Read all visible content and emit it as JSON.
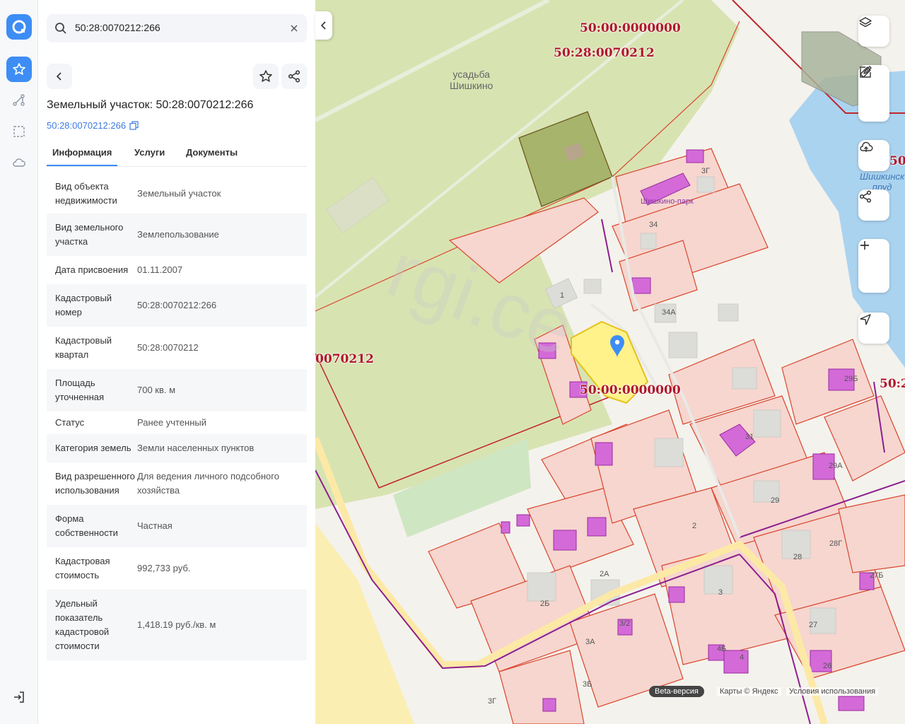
{
  "search": {
    "query": "50:28:0070212:266"
  },
  "object": {
    "title": "Земельный участок: 50:28:0070212:266",
    "cad_link": "50:28:0070212:266"
  },
  "tabs": [
    {
      "label": "Информация"
    },
    {
      "label": "Услуги"
    },
    {
      "label": "Документы"
    }
  ],
  "attributes": [
    {
      "label": "Вид объекта недвижимости",
      "value": "Земельный участок"
    },
    {
      "label": "Вид земельного участка",
      "value": "Землепользование"
    },
    {
      "label": "Дата присвоения",
      "value": "01.11.2007"
    },
    {
      "label": "Кадастровый номер",
      "value": "50:28:0070212:266"
    },
    {
      "label": "Кадастровый квартал",
      "value": "50:28:0070212"
    },
    {
      "label": "Площадь уточненная",
      "value": "700 кв. м"
    },
    {
      "label": "Статус",
      "value": "Ранее учтенный"
    },
    {
      "label": "Категория земель",
      "value": "Земли населенных пунктов"
    },
    {
      "label": "Вид разрешенного использования",
      "value": "Для ведения личного подсобного хозяйства"
    },
    {
      "label": "Форма собственности",
      "value": "Частная"
    },
    {
      "label": "Кадастровая стоимость",
      "value": "992,733 руб."
    },
    {
      "label": "Удельный показатель кадастровой стоимости",
      "value": "1,418.19 руб./кв. м"
    }
  ],
  "map": {
    "cad_labels": {
      "top_quarter": "50:00:0000000",
      "top_block": "50:28:0070212",
      "left_block": "0070212",
      "center_quarter": "50:00:0000000",
      "right_block": "50:2",
      "right_top": "50:"
    },
    "places": {
      "estate_line1": "усадьба",
      "estate_line2": "Шишкино",
      "park": "Шишкино-парк",
      "pond_line1": "Шишкинск",
      "pond_line2": "пруд"
    },
    "houses": {
      "h34": "34",
      "h34a": "34А",
      "h1": "1",
      "h31": "31",
      "h29b": "29Б",
      "h29a": "29А",
      "h29": "29",
      "h2a": "2А",
      "h2b": "2Б",
      "h3": "3",
      "h3a": "3А",
      "h3b": "3Б",
      "h3v": "3Г",
      "h28": "28",
      "h28g": "28Г",
      "h27b": "27Б",
      "h27": "27",
      "h26": "26",
      "h4": "4",
      "h4b": "4Б",
      "h3g": "3Г",
      "h2": "2",
      "h32": "3/2"
    },
    "beta": "Beta-версия",
    "copyright": "Карты © Яндекс",
    "terms": "Условия использования"
  },
  "colors": {
    "accent": "#3d8df5",
    "boundary": "#d9452e",
    "cad_label": "#b0162b",
    "selected_plot": "#fff28a",
    "building": "#d36ad8"
  }
}
